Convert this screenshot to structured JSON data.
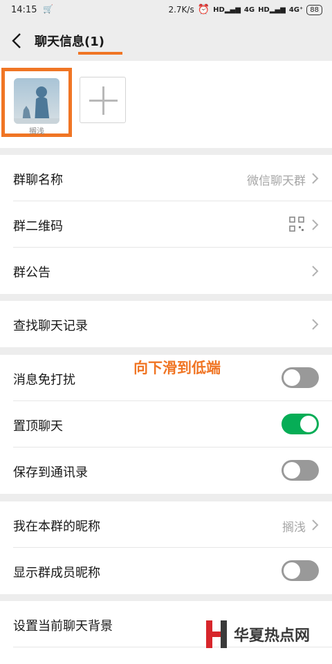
{
  "status_bar": {
    "time": "14:15",
    "network_speed": "2.7K/s",
    "signal_1": "4G",
    "signal_2": "4G⁺",
    "battery": "88"
  },
  "header": {
    "title": "聊天信息(1)",
    "back_icon": "chevron-left-icon"
  },
  "members": {
    "items": [
      {
        "name": "搁浅"
      }
    ],
    "add_icon": "plus-icon"
  },
  "group_info": {
    "name_label": "群聊名称",
    "name_value": "微信聊天群",
    "qrcode_label": "群二维码",
    "notice_label": "群公告"
  },
  "search": {
    "label": "查找聊天记录"
  },
  "settings": {
    "mute_label": "消息免打扰",
    "mute_on": false,
    "pin_label": "置顶聊天",
    "pin_on": true,
    "save_label": "保存到通讯录",
    "save_on": false
  },
  "nickname": {
    "my_label": "我在本群的昵称",
    "my_value": "搁浅",
    "show_label": "显示群成员昵称",
    "show_on": false
  },
  "background": {
    "label": "设置当前聊天背景"
  },
  "annotation": {
    "text": "向下滑到低端"
  },
  "watermark": {
    "text": "华夏热点网"
  },
  "colors": {
    "accent": "#f07524",
    "toggle_on": "#06ad56",
    "toggle_off": "#999999"
  }
}
